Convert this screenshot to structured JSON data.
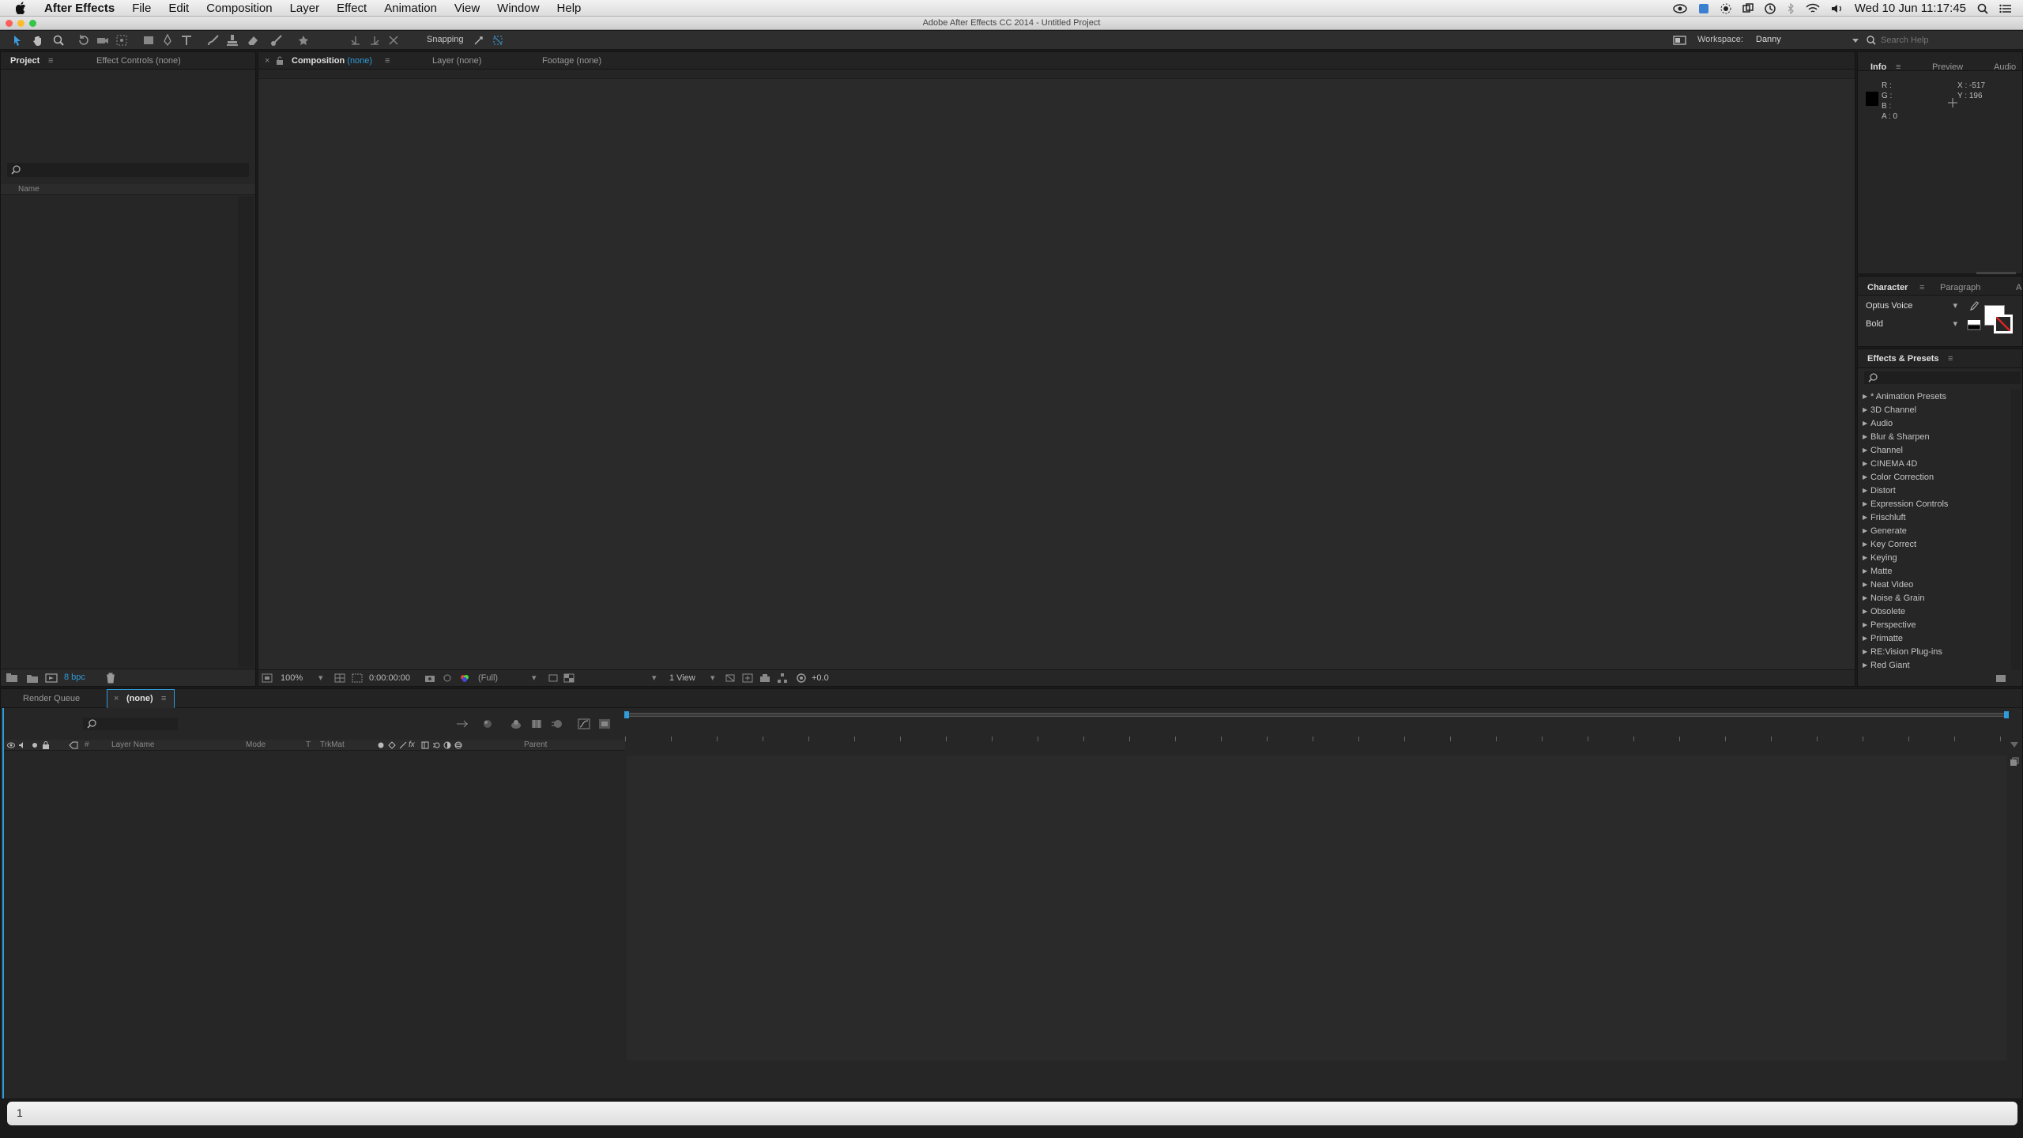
{
  "menubar": {
    "app_name": "After Effects",
    "items": [
      "File",
      "Edit",
      "Composition",
      "Layer",
      "Effect",
      "Animation",
      "View",
      "Window",
      "Help"
    ],
    "clock": "Wed 10 Jun  11:17:45"
  },
  "window": {
    "title": "Adobe After Effects CC 2014 - Untitled Project"
  },
  "toolbar": {
    "snapping_label": "Snapping",
    "workspace_label": "Workspace:",
    "workspace_value": "Danny",
    "search_help_placeholder": "Search Help"
  },
  "project_panel": {
    "tabs": {
      "project": "Project",
      "effect_controls": "Effect Controls (none)"
    },
    "name_column": "Name",
    "bpc": "8 bpc"
  },
  "viewer_panel": {
    "tab_composition": "Composition",
    "tab_composition_value": "(none)",
    "tab_layer": "Layer (none)",
    "tab_footage": "Footage (none)",
    "zoom": "100%",
    "timecode": "0:00:00:00",
    "resolution": "(Full)",
    "views": "1 View",
    "exposure": "+0.0"
  },
  "info_panel": {
    "tabs": {
      "info": "Info",
      "preview": "Preview",
      "audio": "Audio"
    },
    "r": "R :",
    "g": "G :",
    "b": "B :",
    "a": "A : 0",
    "x": "X : -517",
    "y": "Y : 196"
  },
  "character_panel": {
    "tabs": {
      "character": "Character",
      "paragraph": "Paragraph",
      "more": "A"
    },
    "font": "Optus Voice",
    "style": "Bold"
  },
  "effects_panel": {
    "title": "Effects & Presets",
    "items": [
      "* Animation Presets",
      "3D Channel",
      "Audio",
      "Blur & Sharpen",
      "Channel",
      "CINEMA 4D",
      "Color Correction",
      "Distort",
      "Expression Controls",
      "Frischluft",
      "Generate",
      "Key Correct",
      "Keying",
      "Matte",
      "Neat Video",
      "Noise & Grain",
      "Obsolete",
      "Perspective",
      "Primatte",
      "RE:Vision Plug-ins",
      "Red Giant"
    ]
  },
  "timeline": {
    "tab_render_queue": "Render Queue",
    "tab_comp": "(none)",
    "columns": {
      "hash": "#",
      "layer_name": "Layer Name",
      "mode": "Mode",
      "t": "T",
      "trkmat": "TrkMat",
      "parent": "Parent"
    }
  },
  "bottom_bar": {
    "value": "1"
  }
}
